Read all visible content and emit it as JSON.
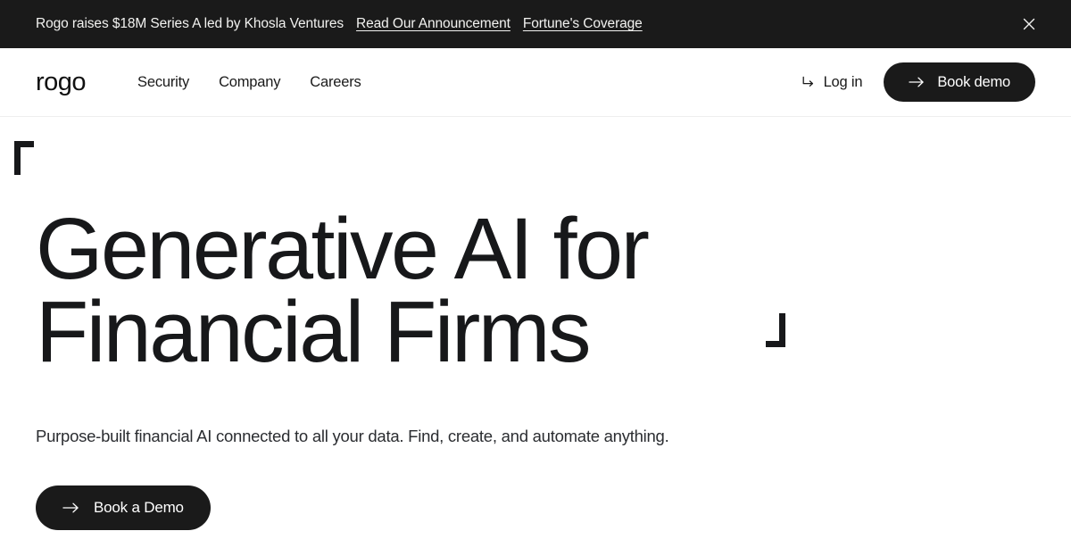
{
  "announcement": {
    "text": "Rogo raises $18M Series A led by Khosla Ventures",
    "link1": "Read Our Announcement",
    "link2": "Fortune's Coverage",
    "close_icon": "close-icon",
    "background_color": "#1a1a1a",
    "text_color": "#f2f2f0"
  },
  "header": {
    "logo": "rogo",
    "nav": [
      {
        "label": "Security"
      },
      {
        "label": "Company"
      },
      {
        "label": "Careers"
      }
    ],
    "login": {
      "label": "Log in",
      "icon": "arrow-turn-down-right-icon"
    },
    "book_demo": {
      "label": "Book demo",
      "icon": "arrow-right-icon",
      "background_color": "#1a1a1a"
    }
  },
  "hero": {
    "headline_line1": "Generative AI for",
    "headline_line2": "Financial Firms",
    "subheadline": "Purpose-built financial AI connected to all your data. Find, create, and automate anything.",
    "cta": {
      "label": "Book a Demo",
      "icon": "arrow-right-icon",
      "background_color": "#1a1a1a"
    },
    "bracket_top_left": "corner-bracket-top-left",
    "bracket_bottom_right": "corner-bracket-bottom-right",
    "text_color": "#17181a"
  }
}
